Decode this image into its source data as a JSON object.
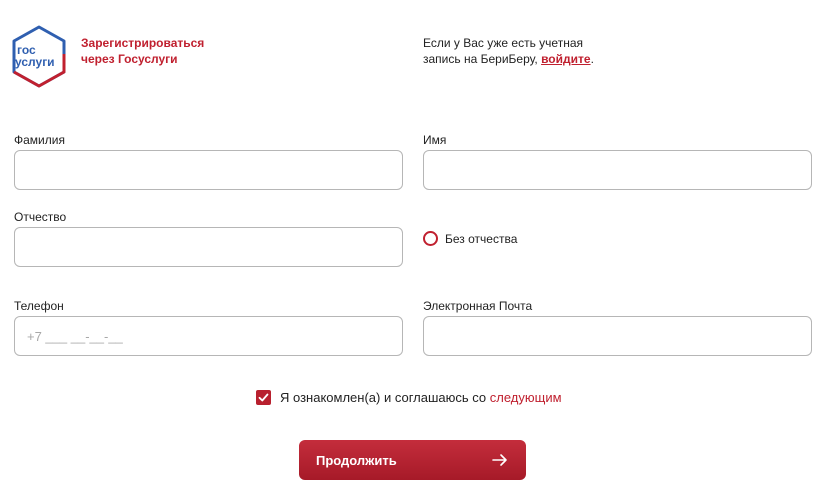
{
  "gosuslugi": {
    "logo_line1": "гос",
    "logo_line2": "услуги",
    "link_line1": "Зарегистрироваться",
    "link_line2": "через Госуслуги"
  },
  "login": {
    "text_line1": "Если у Вас уже есть учетная",
    "text_line2": "запись на БериБеру, ",
    "link": "войдите",
    "suffix": "."
  },
  "form": {
    "last_name": {
      "label": "Фамилия",
      "value": ""
    },
    "first_name": {
      "label": "Имя",
      "value": ""
    },
    "patronymic": {
      "label": "Отчество",
      "value": ""
    },
    "no_patronymic": {
      "label": "Без отчества",
      "checked": false
    },
    "phone": {
      "label": "Телефон",
      "placeholder": "+7 ___ __-__-__"
    },
    "email": {
      "label": "Электронная Почта",
      "value": ""
    }
  },
  "consent": {
    "text": "Я ознакомлен(а) и соглашаюсь со ",
    "link": "следующим",
    "checked": true
  },
  "continue_button": {
    "label": "Продолжить"
  },
  "colors": {
    "accent": "#c0202f",
    "logo_blue": "#2f5fb0",
    "border": "#b6b6b6"
  }
}
